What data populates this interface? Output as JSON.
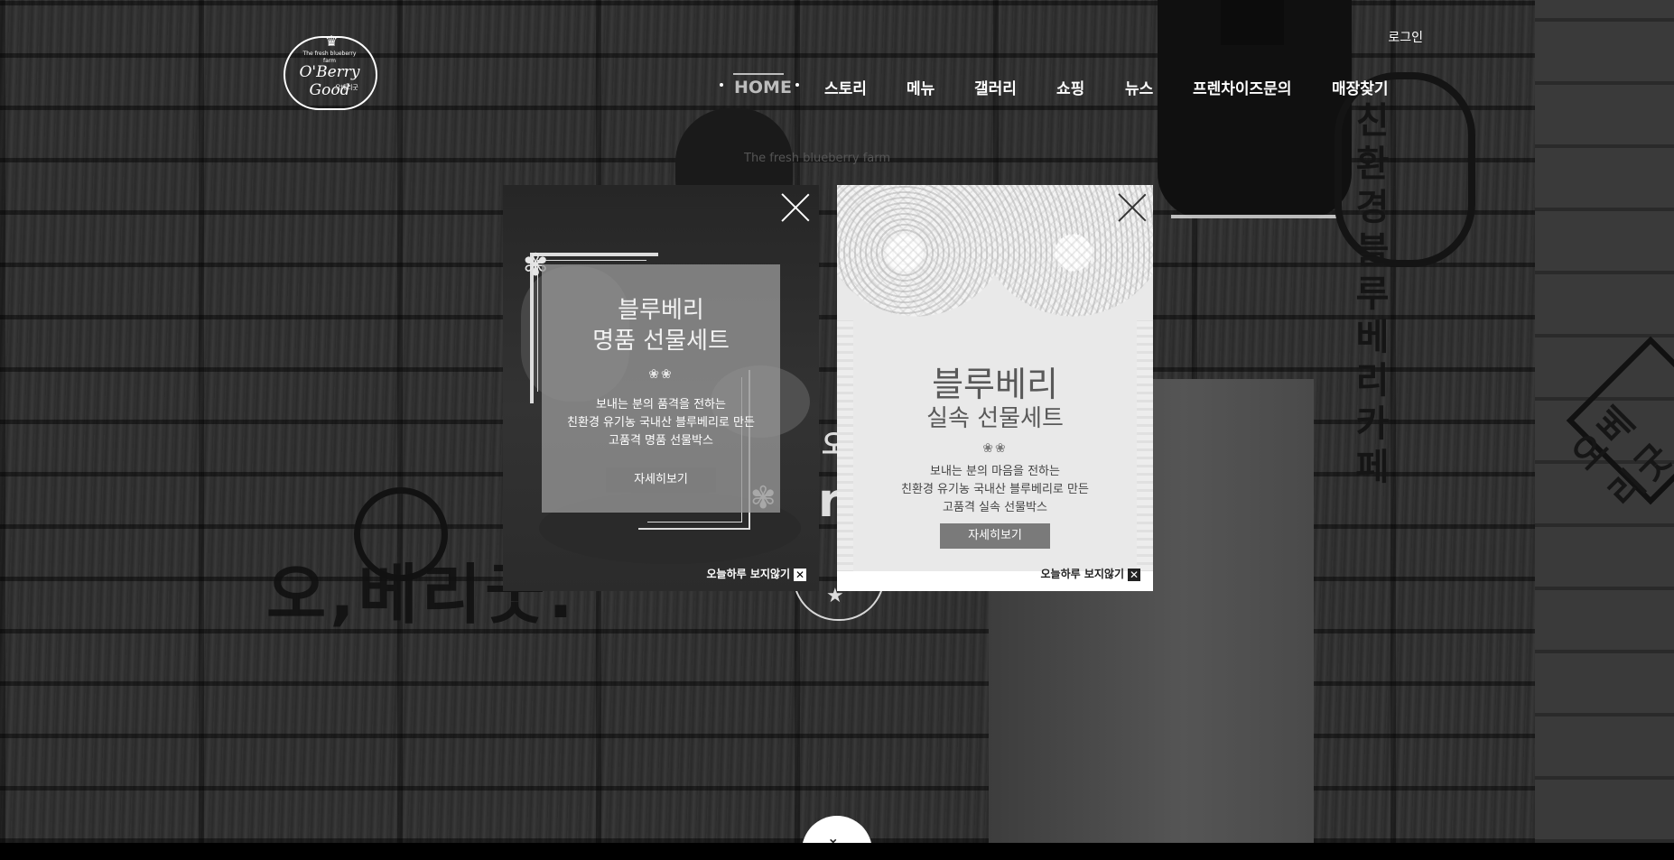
{
  "header": {
    "logo": {
      "tagline": "The fresh blueberry farm",
      "brand": "O'Berry Good",
      "brand_korean": "오베리굿"
    },
    "login_label": "로그인",
    "nav": {
      "items": [
        "HOME",
        "스토리",
        "메뉴",
        "갤러리",
        "쇼핑",
        "뉴스",
        "프렌차이즈문의",
        "매장찾기"
      ],
      "active": "HOME"
    }
  },
  "hero": {
    "background_text": "오,베리굿.",
    "sign_text": "The fresh blueberry farm",
    "partial_words": [
      "ry",
      "오"
    ],
    "scroll_icon": "chevron-double-down-icon",
    "star_icon": "star-icon"
  },
  "popups": {
    "left": {
      "title_line1": "블루베리",
      "title_line2": "명품 선물세트",
      "description": [
        "보내는 분의 품격을 전하는",
        "친환경 유기농 국내산 블루베리로 만든",
        "고품격 명품 선물박스"
      ],
      "button_label": "자세히보기",
      "dismiss_label": "오늘하루 보지않기",
      "dismiss_box": "✕",
      "ornament": "❀❀"
    },
    "right": {
      "title_line1": "블루베리",
      "title_line2": "실속 선물세트",
      "description": [
        "보내는 분의 마음을 전하는",
        "친환경 유기농 국내산 블루베리로 만든",
        "고품격 실속 선물박스"
      ],
      "button_label": "자세히보기",
      "dismiss_label": "오늘하루 보지않기",
      "dismiss_box": "✕",
      "ornament": "❀❀"
    }
  },
  "colors": {
    "nav_active": "#bdbdbd",
    "button_gray": "#7a7a7a",
    "popup_right_bg": "#e9e9e9"
  }
}
